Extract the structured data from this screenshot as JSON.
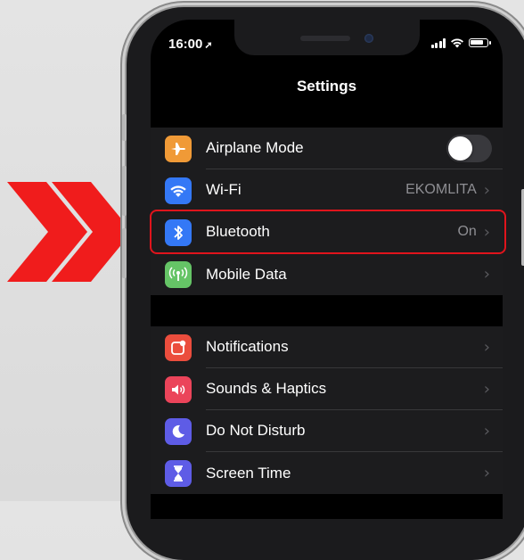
{
  "status_bar": {
    "time": "16:00",
    "location_arrow": "location-arrow-icon"
  },
  "nav": {
    "title": "Settings"
  },
  "group1": [
    {
      "label": "Airplane Mode",
      "icon": "airplane-icon",
      "icon_color": "#f09a37",
      "toggle": false
    },
    {
      "label": "Wi-Fi",
      "value": "EKOMLITA",
      "icon": "wifi-icon",
      "icon_color": "#3478f6"
    },
    {
      "label": "Bluetooth",
      "value": "On",
      "icon": "bluetooth-icon",
      "icon_color": "#3478f6"
    },
    {
      "label": "Mobile Data",
      "icon": "antenna-icon",
      "icon_color": "#65c466"
    }
  ],
  "group2": [
    {
      "label": "Notifications",
      "icon": "notifications-icon",
      "icon_color": "#eb4d3d"
    },
    {
      "label": "Sounds & Haptics",
      "icon": "speaker-icon",
      "icon_color": "#eb445a"
    },
    {
      "label": "Do Not Disturb",
      "icon": "moon-icon",
      "icon_color": "#5e5ce6"
    },
    {
      "label": "Screen Time",
      "icon": "hourglass-icon",
      "icon_color": "#5e5ce6"
    }
  ],
  "annotation": {
    "highlight_color": "#e0141c",
    "arrow_color": "#f01c1c",
    "highlighted_row": "Bluetooth"
  }
}
